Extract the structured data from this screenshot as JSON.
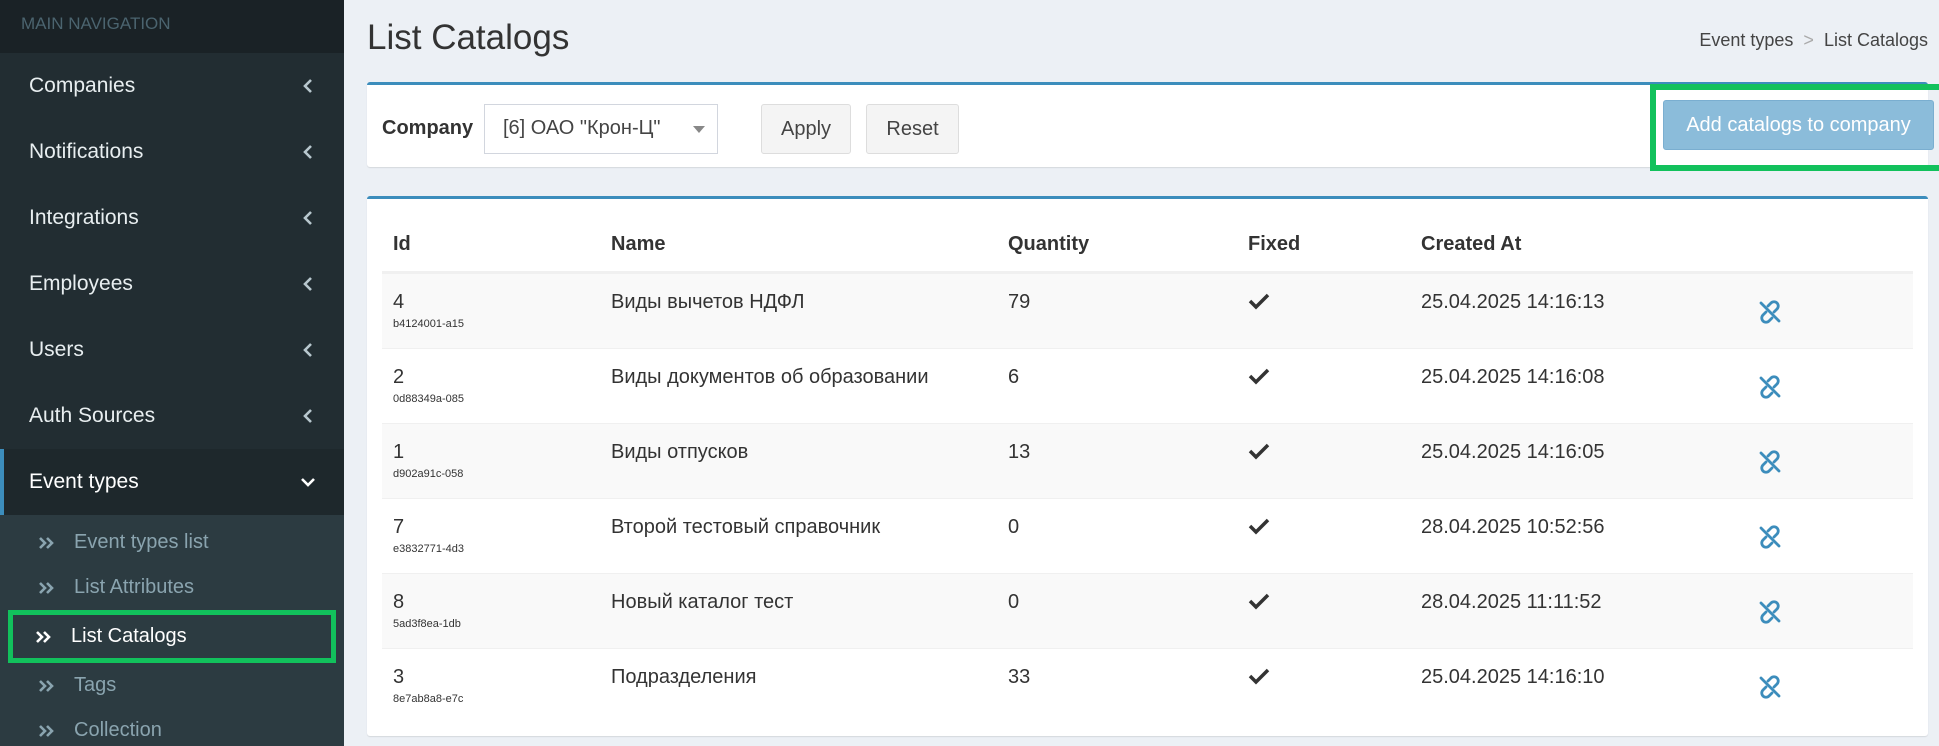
{
  "sidebar": {
    "header": "MAIN NAVIGATION",
    "items": [
      {
        "label": "Companies"
      },
      {
        "label": "Notifications"
      },
      {
        "label": "Integrations"
      },
      {
        "label": "Employees"
      },
      {
        "label": "Users"
      },
      {
        "label": "Auth Sources"
      },
      {
        "label": "Event types"
      }
    ],
    "submenu": [
      {
        "label": "Event types list"
      },
      {
        "label": "List Attributes"
      },
      {
        "label": "List Catalogs"
      },
      {
        "label": "Tags"
      },
      {
        "label": "Collection"
      }
    ]
  },
  "page": {
    "title": "List Catalogs",
    "breadcrumb": [
      "Event types",
      ">",
      "List Catalogs"
    ]
  },
  "filter": {
    "label": "Company",
    "selected": "[6] ОАО \"Крон-Ц\"",
    "apply": "Apply",
    "reset": "Reset",
    "add": "Add catalogs to company"
  },
  "table": {
    "headers": [
      "Id",
      "Name",
      "Quantity",
      "Fixed",
      "Created At"
    ],
    "rows": [
      {
        "id": "4",
        "uuid": "b4124001-a15",
        "name": "Виды вычетов НДФЛ",
        "quantity": "79",
        "created": "25.04.2025 14:16:13"
      },
      {
        "id": "2",
        "uuid": "0d88349a-085",
        "name": "Виды документов об образовании",
        "quantity": "6",
        "created": "25.04.2025 14:16:08"
      },
      {
        "id": "1",
        "uuid": "d902a91c-058",
        "name": "Виды отпусков",
        "quantity": "13",
        "created": "25.04.2025 14:16:05"
      },
      {
        "id": "7",
        "uuid": "e3832771-4d3",
        "name": "Второй тестовый справочник",
        "quantity": "0",
        "created": "28.04.2025 10:52:56"
      },
      {
        "id": "8",
        "uuid": "5ad3f8ea-1db",
        "name": "Новый каталог тест",
        "quantity": "0",
        "created": "28.04.2025 11:11:52"
      },
      {
        "id": "3",
        "uuid": "8e7ab8a8-e7c",
        "name": "Подразделения",
        "quantity": "33",
        "created": "25.04.2025 14:16:10"
      }
    ]
  },
  "colors": {
    "sidebar_bg": "#222d32",
    "accent": "#3c8dbc",
    "highlight": "#12c15c",
    "add_button": "#8bbcda"
  }
}
